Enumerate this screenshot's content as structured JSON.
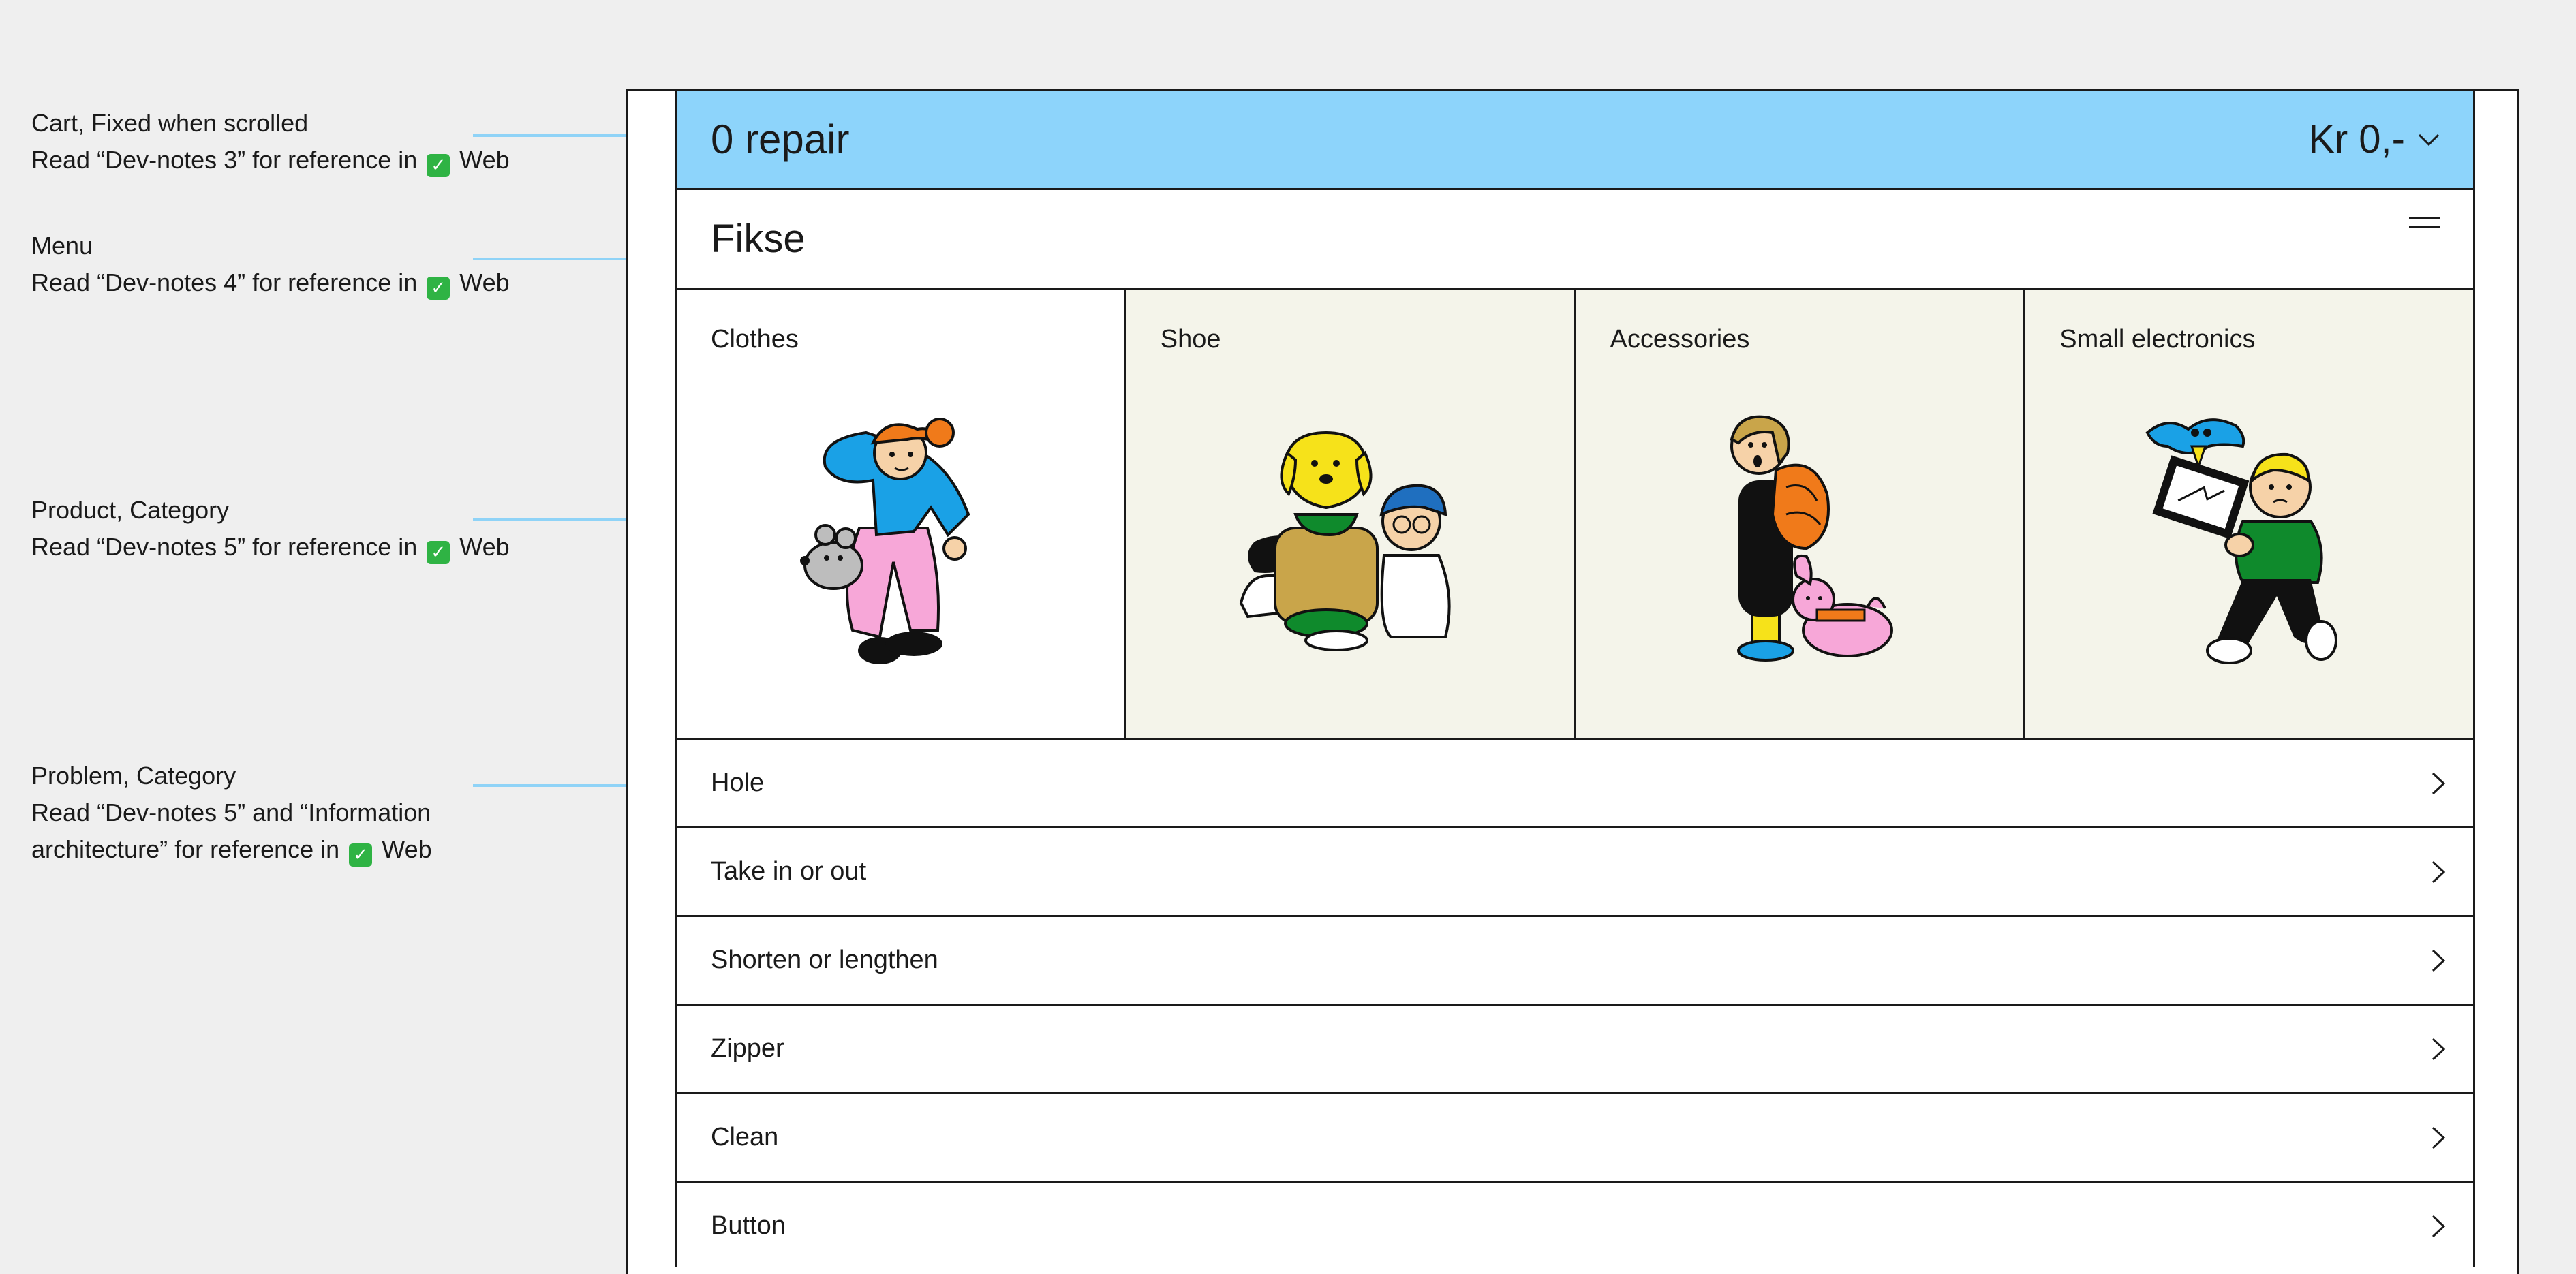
{
  "annotations": [
    {
      "title": "Cart, Fixed when scrolled",
      "lines": [
        "Read “Dev-notes 3” for reference in",
        "Web"
      ]
    },
    {
      "title": "Menu",
      "lines": [
        "Read “Dev-notes 4” for reference in",
        "Web"
      ]
    },
    {
      "title": "Product, Category",
      "lines": [
        "Read “Dev-notes 5” for reference in",
        "Web"
      ]
    },
    {
      "title": "Problem, Category",
      "lines": [
        "Read “Dev-notes 5” and “Information",
        "architecture” for reference in",
        "Web"
      ]
    }
  ],
  "cart": {
    "count_label": "0 repair",
    "total": "Kr 0,-",
    "chevron": "chevron-down-icon"
  },
  "header": {
    "logo": "Fikse",
    "menu_icon": "menu-icon"
  },
  "categories": [
    {
      "label": "Clothes"
    },
    {
      "label": "Shoe"
    },
    {
      "label": "Accessories"
    },
    {
      "label": "Small electronics"
    }
  ],
  "problems": [
    {
      "label": "Hole"
    },
    {
      "label": "Take in or out"
    },
    {
      "label": "Shorten or lengthen"
    },
    {
      "label": "Zipper"
    },
    {
      "label": "Clean"
    },
    {
      "label": "Button"
    }
  ],
  "colors": {
    "accent": "#8dd4fb",
    "tint": "#f4f4ea",
    "check": "#2fb344"
  }
}
